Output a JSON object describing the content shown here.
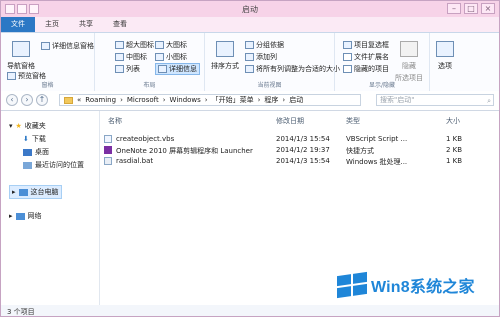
{
  "window": {
    "title": "启动",
    "buttons": {
      "min": "–",
      "max": "□",
      "close": "×"
    }
  },
  "tabs": [
    {
      "label": "文件"
    },
    {
      "label": "主页"
    },
    {
      "label": "共享"
    },
    {
      "label": "查看"
    }
  ],
  "ribbon": {
    "panes": {
      "nav_pane": "导航窗格",
      "preview_pane": "预览窗格",
      "details_pane": "详细信息窗格",
      "group_name": "窗格"
    },
    "layout": {
      "items": [
        "超大图标",
        "大图标",
        "中图标",
        "小图标",
        "列表",
        "详细信息"
      ],
      "group_name": "布局"
    },
    "current_view": {
      "sort": "排序方式",
      "group_by": "分组依据",
      "add_columns": "添加列",
      "fit_columns": "将所有列调整为合适的大小",
      "group_name": "当前视图"
    },
    "show_hide": {
      "item_checkbox": "项目复选框",
      "file_ext": "文件扩展名",
      "hidden_items": "隐藏的项目",
      "hide_selected": "隐藏",
      "hide_selected_sub": "所选项目",
      "group_name": "显示/隐藏"
    },
    "options": {
      "label": "选项"
    }
  },
  "address": {
    "path": [
      "Roaming",
      "Microsoft",
      "Windows",
      "「开始」菜单",
      "程序",
      "启动"
    ],
    "search_placeholder": "搜索\"启动\""
  },
  "navpane": {
    "items": [
      "收藏夹",
      "下载",
      "桌面",
      "最近访问的位置",
      "这台电脑",
      "网络"
    ]
  },
  "table": {
    "columns": [
      "名称",
      "修改日期",
      "类型",
      "大小"
    ],
    "rows": [
      {
        "name": "createobject.vbs",
        "date": "2014/1/3 15:54",
        "type": "VBScript Script ...",
        "size": "1 KB"
      },
      {
        "name": "OneNote 2010 屏幕剪辑程序和 Launcher",
        "date": "2014/1/2 19:37",
        "type": "快捷方式",
        "size": "2 KB"
      },
      {
        "name": "rasdial.bat",
        "date": "2014/1/3 15:54",
        "type": "Windows 批处理...",
        "size": "1 KB"
      }
    ]
  },
  "status": {
    "count": "3 个项目"
  },
  "watermark": {
    "brand": "Win8系统之家"
  }
}
